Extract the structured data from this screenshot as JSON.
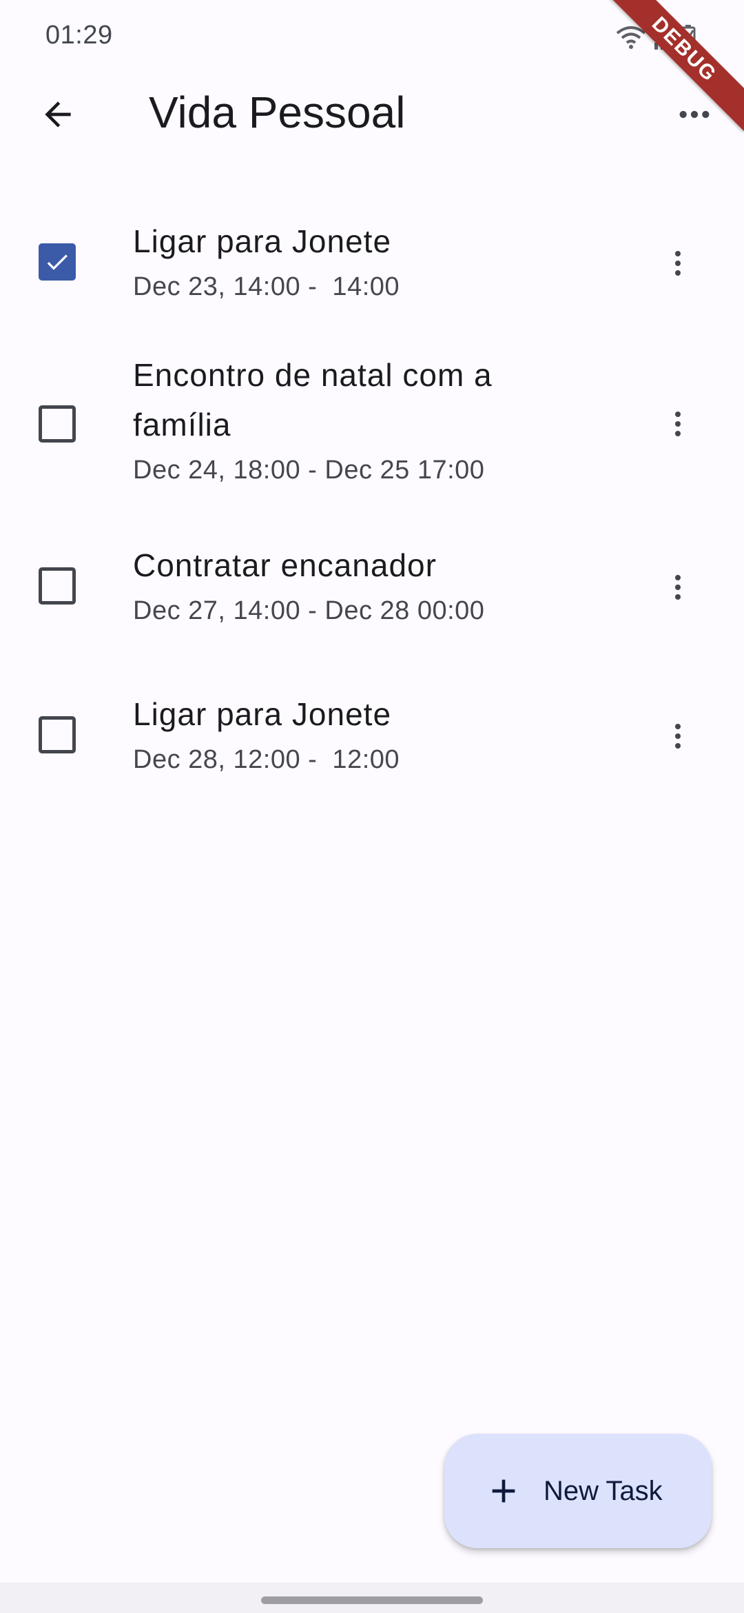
{
  "status_bar": {
    "time": "01:29",
    "icons": [
      "wifi-icon",
      "signal-icon",
      "battery-icon"
    ]
  },
  "debug_banner": "DEBUG",
  "app_bar": {
    "back_icon": "arrow-left-icon",
    "title": "Vida Pessoal",
    "menu_icon": "more-horizontal-icon"
  },
  "tasks": [
    {
      "title": "Ligar para Jonete",
      "subtitle": "Dec 23, 14:00 -  14:00",
      "checked": true
    },
    {
      "title": "Encontro de natal com a família",
      "subtitle": "Dec 24, 18:00 - Dec 25 17:00",
      "checked": false
    },
    {
      "title": "Contratar encanador",
      "subtitle": "Dec 27, 14:00 - Dec 28 00:00",
      "checked": false
    },
    {
      "title": "Ligar para Jonete",
      "subtitle": "Dec 28, 12:00 -  12:00",
      "checked": false
    }
  ],
  "fab": {
    "icon": "plus-icon",
    "label": "New Task"
  },
  "colors": {
    "background": "#fdfbff",
    "accent": "#3b5ba9",
    "fab_background": "#dce2fc",
    "debug_banner": "#a4302b"
  }
}
